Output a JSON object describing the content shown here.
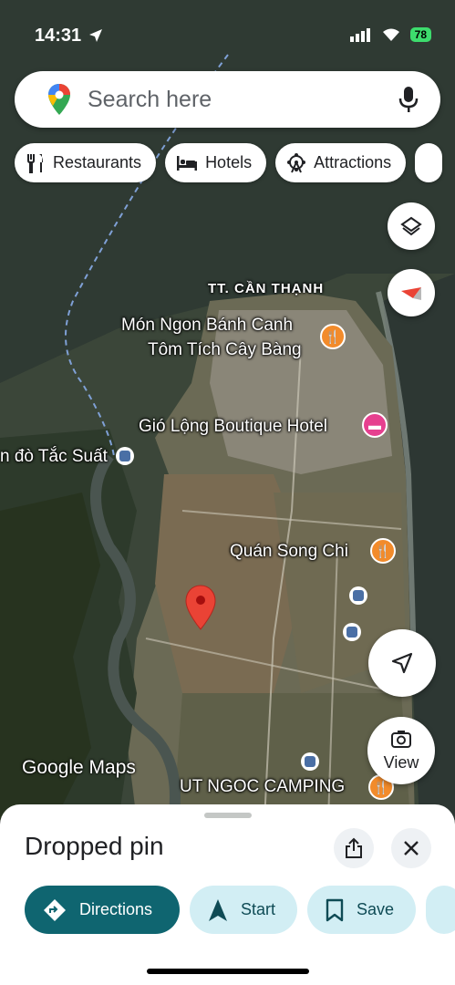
{
  "status_bar": {
    "time": "14:31",
    "battery": "78"
  },
  "search": {
    "placeholder": "Search here"
  },
  "chips": [
    {
      "label": "Restaurants",
      "icon": "fork-knife-icon"
    },
    {
      "label": "Hotels",
      "icon": "bed-icon"
    },
    {
      "label": "Attractions",
      "icon": "ferris-wheel-icon"
    }
  ],
  "map": {
    "labels": {
      "town": "TT. CẦN THẠNH",
      "restaurant_1_line1": "Món Ngon Bánh Canh",
      "restaurant_1_line2": "Tôm Tích Cây Bàng",
      "hotel": "Gió Lộng Boutique Hotel",
      "ferry": "n đò Tắc Suất",
      "restaurant_2": "Quán Song Chi",
      "camping": "UT NGOC CAMPING"
    },
    "branding": "Google Maps"
  },
  "fab": {
    "view_label": "View"
  },
  "sheet": {
    "title": "Dropped pin",
    "actions": {
      "directions": "Directions",
      "start": "Start",
      "save": "Save"
    }
  },
  "colors": {
    "primary_action": "#0f6570",
    "secondary_action": "#d2eef4",
    "pin_red": "#ea4335",
    "food_poi": "#f28b2b",
    "hotel_poi": "#e6408f"
  }
}
